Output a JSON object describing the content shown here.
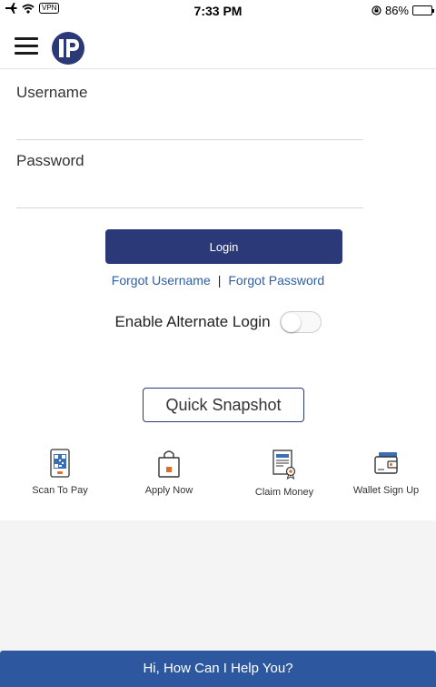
{
  "status_bar": {
    "vpn": "VPN",
    "time": "7:33 PM",
    "battery": "86%",
    "battery_level": 0.86
  },
  "header": {
    "menu_icon": "hamburger-menu-icon",
    "logo_icon": "ip-logo-icon"
  },
  "form": {
    "username_label": "Username",
    "username_value": "",
    "password_label": "Password",
    "password_value": "",
    "login_label": "Login",
    "forgot_username": "Forgot Username",
    "separator": "|",
    "forgot_password": "Forgot Password",
    "alt_login_label": "Enable Alternate Login",
    "alt_login_enabled": false
  },
  "snapshot_label": "Quick Snapshot",
  "quick_actions": [
    {
      "label": "Scan To Pay",
      "icon": "qr-phone-icon"
    },
    {
      "label": "Apply Now",
      "icon": "shopping-bag-icon"
    },
    {
      "label": "Claim Money",
      "icon": "certificate-icon"
    },
    {
      "label": "Wallet Sign Up",
      "icon": "wallet-icon"
    }
  ],
  "help_label": "Hi, How Can I Help You?",
  "colors": {
    "primary": "#2c3979",
    "link": "#2c5fa7",
    "help_bar": "#2d58a0",
    "gray_area": "#f4f4f4"
  }
}
